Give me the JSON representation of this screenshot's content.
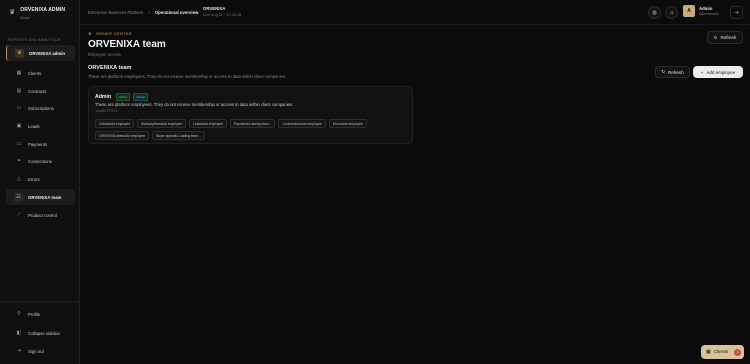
{
  "brand": {
    "title": "ORVENIXA ADMIN",
    "subtitle": "Buyer"
  },
  "sidebar": {
    "section_label": "REPORTS AND ANALYTICS",
    "items": [
      {
        "label": "ORVENIXA admin",
        "icon": "crown-icon"
      },
      {
        "label": "Clients",
        "icon": "building-icon"
      },
      {
        "label": "Contracts",
        "icon": "document-icon"
      },
      {
        "label": "Subscriptions",
        "icon": "card-icon"
      },
      {
        "label": "Leads",
        "icon": "inbox-icon"
      },
      {
        "label": "Payments",
        "icon": "wallet-icon"
      },
      {
        "label": "Connections",
        "icon": "link-icon"
      },
      {
        "label": "Errors",
        "icon": "alert-icon"
      },
      {
        "label": "ORVENIXA team",
        "icon": "users-icon"
      },
      {
        "label": "Product control",
        "icon": "sliders-icon"
      }
    ],
    "bottom": [
      {
        "label": "Profile",
        "icon": "user-icon"
      },
      {
        "label": "Collapse sidebar",
        "icon": "collapse-icon"
      },
      {
        "label": "Sign out",
        "icon": "logout-icon"
      }
    ]
  },
  "topbar": {
    "breadcrumb_root": "Enterprise Business Platform",
    "breadcrumb_sep": "›",
    "breadcrumb_current": "Operational overview",
    "tenant_name": "ORVENIXA",
    "tenant_date": "Mon Aug 11 · 22:48:18",
    "user_initial": "A",
    "user_name": "Admin",
    "user_role": "Administrator"
  },
  "page": {
    "overline": "OWNER CENTER",
    "title": "ORVENIXA team",
    "subtitle": "Employee access",
    "refresh_label": "Refresh"
  },
  "team": {
    "title": "ORVENIXA team",
    "description": "These are platform employees. They do not receive membership or access to data within client companies.",
    "refresh_label": "Refresh",
    "add_label": "Add employee",
    "card": {
      "name": "Admin",
      "badge_active": "Active",
      "badge_owner": "Owner",
      "description": "These are platform employees. They do not receive membership or access to data within client companies.",
      "code": "Y8dE07T0C1",
      "chips": [
        "ClientsAdd employee",
        "SubscriptionsAdd employee",
        "LeadsAdd employee",
        "PaymentsLoading team...",
        "ConnectionsAdd employee",
        "ErrorsAdd employee",
        "ORVENIXA teamAdd employee",
        "Buyer appeals Loading team..."
      ]
    }
  },
  "floating": {
    "label": "Clients",
    "count": "1"
  },
  "colors": {
    "accent": "#d4b886",
    "background": "#0b0b0b",
    "active_badge": "#5fd18c",
    "owner_badge": "#5ec8d6",
    "notification": "#c94a3f"
  }
}
